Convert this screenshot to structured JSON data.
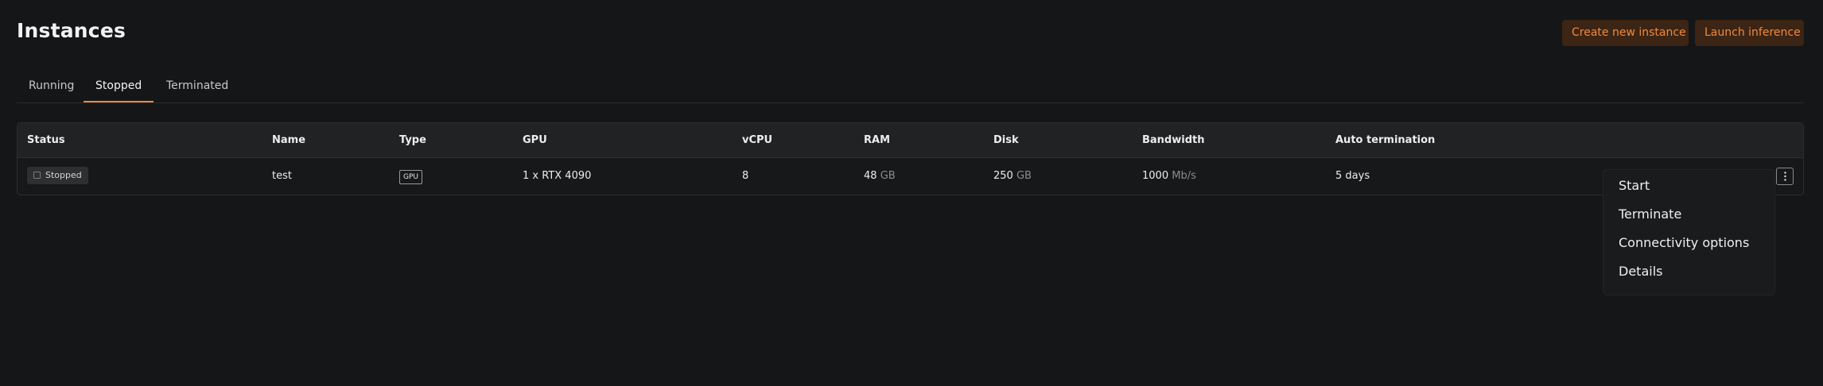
{
  "header": {
    "title": "Instances",
    "create_label": "Create new instance",
    "launch_label": "Launch inference"
  },
  "tabs": [
    {
      "label": "Running"
    },
    {
      "label": "Stopped",
      "active": true
    },
    {
      "label": "Terminated"
    }
  ],
  "table": {
    "columns": [
      "Status",
      "Name",
      "Type",
      "GPU",
      "vCPU",
      "RAM",
      "Disk",
      "Bandwidth",
      "Auto termination"
    ],
    "rows": [
      {
        "status": "Stopped",
        "name": "test",
        "type": "GPU",
        "gpu": "1 x RTX 4090",
        "vcpu": "8",
        "ram_value": "48",
        "ram_unit": "GB",
        "disk_value": "250",
        "disk_unit": "GB",
        "bandwidth_value": "1000",
        "bandwidth_unit": "Mb/s",
        "auto_termination": "5 days"
      }
    ]
  },
  "row_menu": {
    "items": [
      "Start",
      "Terminate",
      "Connectivity options",
      "Details"
    ]
  },
  "colors": {
    "accent": "#f08a3c",
    "accent_bg": "#3c2514",
    "background": "#151617"
  }
}
